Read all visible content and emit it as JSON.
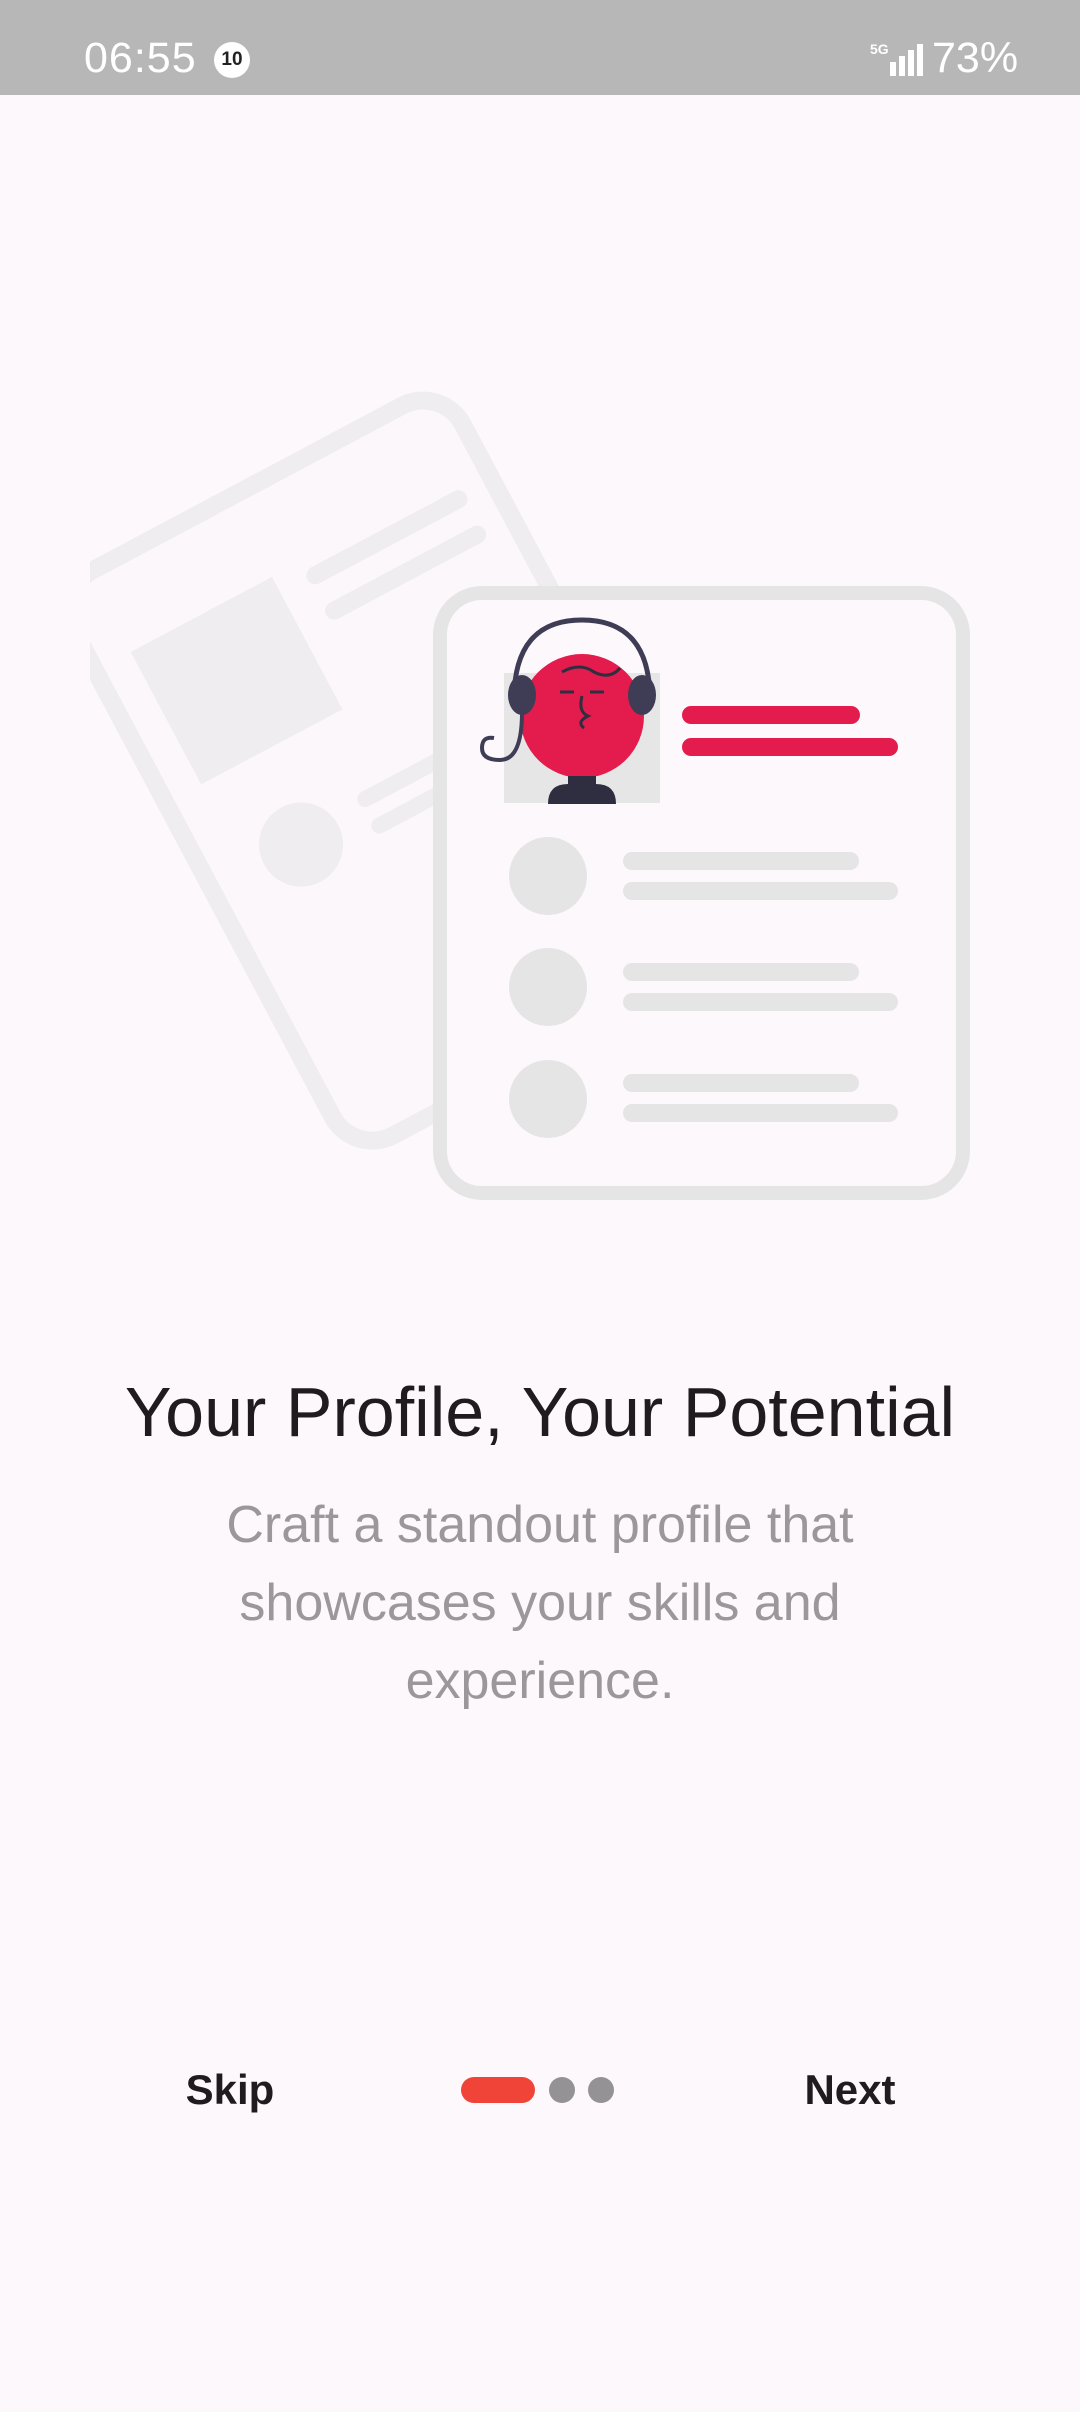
{
  "status_bar": {
    "time": "06:55",
    "notification_count": "10",
    "network": "5G",
    "battery": "73%"
  },
  "onboarding": {
    "title": "Your Profile, Your Potential",
    "subtitle": "Craft a standout profile that showcases your skills and experience.",
    "current_page": 1,
    "total_pages": 3
  },
  "nav": {
    "skip_label": "Skip",
    "next_label": "Next"
  },
  "colors": {
    "accent": "#e31c4d",
    "indicator_active": "#f04438",
    "indicator_inactive": "#959295",
    "background": "#fdf8fc"
  }
}
